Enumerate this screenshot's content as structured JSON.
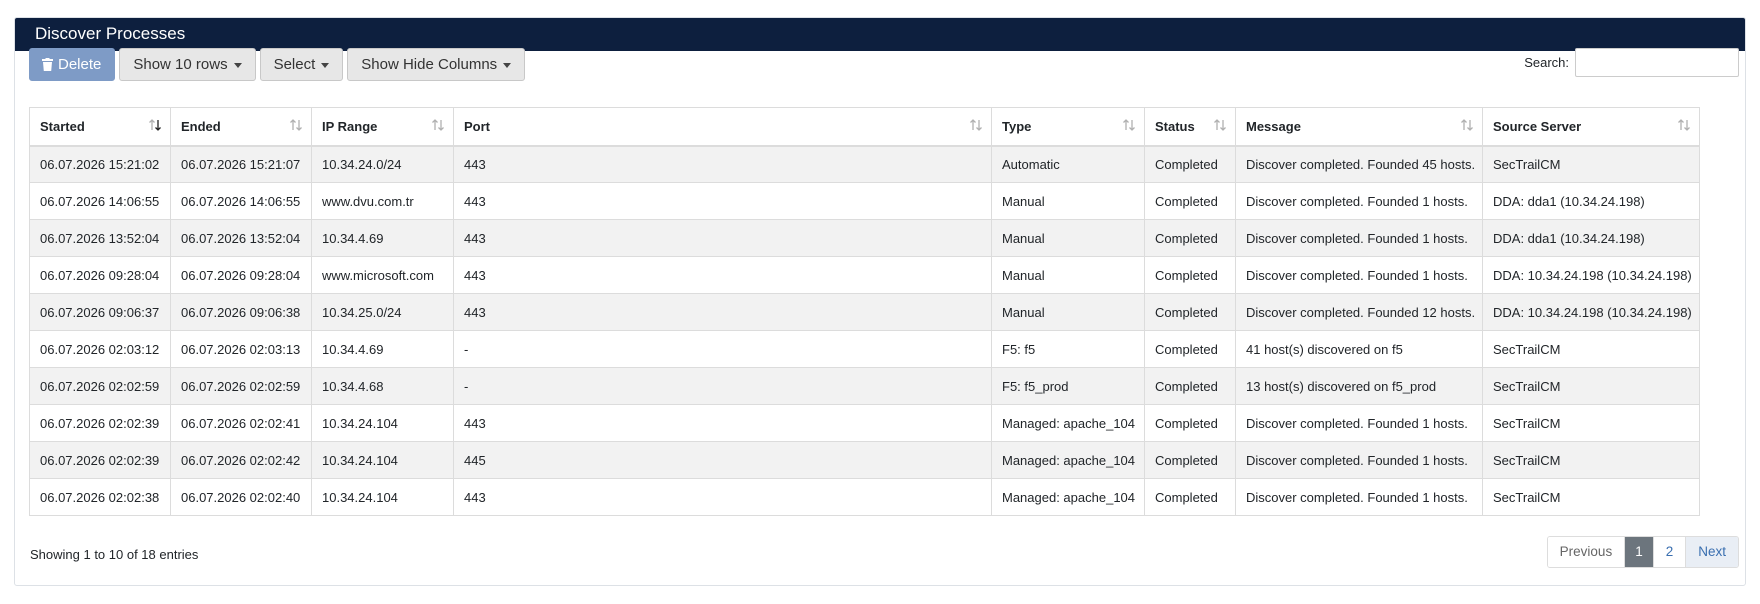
{
  "panel": {
    "title": "Discover Processes"
  },
  "toolbar": {
    "delete_label": "Delete",
    "show_rows_label": "Show 10 rows",
    "select_label": "Select",
    "show_hide_columns_label": "Show Hide Columns"
  },
  "search": {
    "label": "Search:",
    "value": ""
  },
  "table": {
    "columns": [
      "Started",
      "Ended",
      "IP Range",
      "Port",
      "Type",
      "Status",
      "Message",
      "Source Server"
    ],
    "rows": [
      [
        "06.07.2026 15:21:02",
        "06.07.2026 15:21:07",
        "10.34.24.0/24",
        "443",
        "Automatic",
        "Completed",
        "Discover completed. Founded 45 hosts.",
        "SecTrailCM"
      ],
      [
        "06.07.2026 14:06:55",
        "06.07.2026 14:06:55",
        "www.dvu.com.tr",
        "443",
        "Manual",
        "Completed",
        "Discover completed. Founded 1 hosts.",
        "DDA: dda1 (10.34.24.198)"
      ],
      [
        "06.07.2026 13:52:04",
        "06.07.2026 13:52:04",
        "10.34.4.69",
        "443",
        "Manual",
        "Completed",
        "Discover completed. Founded 1 hosts.",
        "DDA: dda1 (10.34.24.198)"
      ],
      [
        "06.07.2026 09:28:04",
        "06.07.2026 09:28:04",
        "www.microsoft.com",
        "443",
        "Manual",
        "Completed",
        "Discover completed. Founded 1 hosts.",
        "DDA: 10.34.24.198 (10.34.24.198)"
      ],
      [
        "06.07.2026 09:06:37",
        "06.07.2026 09:06:38",
        "10.34.25.0/24",
        "443",
        "Manual",
        "Completed",
        "Discover completed. Founded 12 hosts.",
        "DDA: 10.34.24.198 (10.34.24.198)"
      ],
      [
        "06.07.2026 02:03:12",
        "06.07.2026 02:03:13",
        "10.34.4.69",
        "-",
        "F5: f5",
        "Completed",
        "41 host(s) discovered on f5",
        "SecTrailCM"
      ],
      [
        "06.07.2026 02:02:59",
        "06.07.2026 02:02:59",
        "10.34.4.68",
        "-",
        "F5: f5_prod",
        "Completed",
        "13 host(s) discovered on f5_prod",
        "SecTrailCM"
      ],
      [
        "06.07.2026 02:02:39",
        "06.07.2026 02:02:41",
        "10.34.24.104",
        "443",
        "Managed: apache_104",
        "Completed",
        "Discover completed. Founded 1 hosts.",
        "SecTrailCM"
      ],
      [
        "06.07.2026 02:02:39",
        "06.07.2026 02:02:42",
        "10.34.24.104",
        "445",
        "Managed: apache_104",
        "Completed",
        "Discover completed. Founded 1 hosts.",
        "SecTrailCM"
      ],
      [
        "06.07.2026 02:02:38",
        "06.07.2026 02:02:40",
        "10.34.24.104",
        "443",
        "Managed: apache_104",
        "Completed",
        "Discover completed. Founded 1 hosts.",
        "SecTrailCM"
      ]
    ]
  },
  "footer": {
    "info": "Showing 1 to 10 of 18 entries",
    "pagination": {
      "previous": "Previous",
      "page1": "1",
      "page2": "2",
      "next": "Next"
    }
  },
  "colors": {
    "header_bg": "#0d1f3e",
    "delete_bg": "#7e9bc6",
    "active_page": "#6c757d",
    "link": "#3a6fb0"
  }
}
